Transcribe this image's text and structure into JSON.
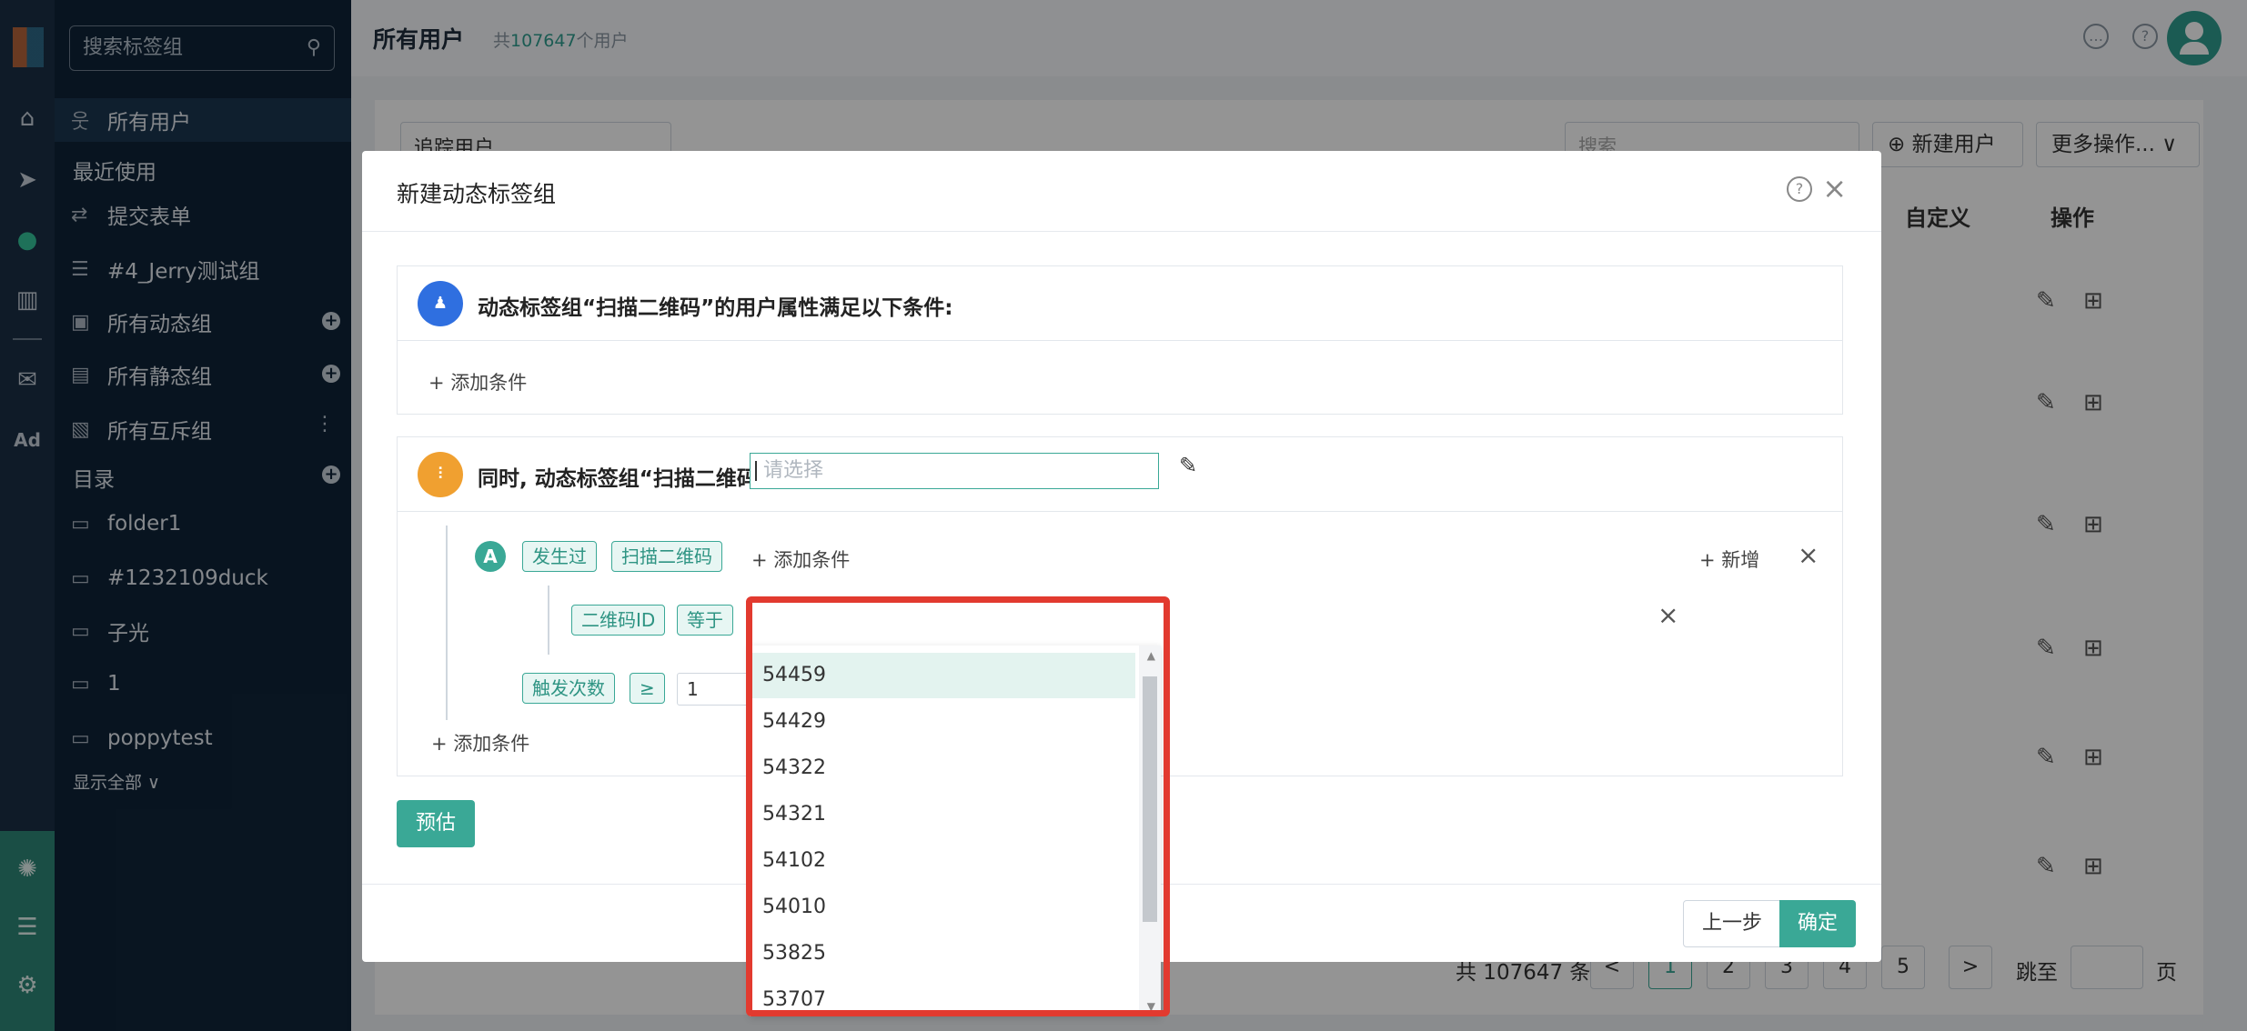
{
  "sidebar": {
    "search_placeholder": "搜索标签组",
    "all_users": "所有用户",
    "recent_label": "最近使用",
    "recent": [
      "提交表单",
      "#4_Jerry测试组"
    ],
    "groups": [
      "所有动态组",
      "所有静态组",
      "所有互斥组"
    ],
    "catalog_label": "目录",
    "folders": [
      "folder1",
      "#1232109duck",
      "子光",
      "1",
      "poppytest"
    ],
    "show_all": "显示全部 ∨"
  },
  "rail": {
    "ad_label": "Ad"
  },
  "header": {
    "title": "所有用户",
    "count_prefix": "共",
    "count_value": "107647",
    "count_suffix": "个用户"
  },
  "background": {
    "filter_select": "追踪用户",
    "search_placeholder": "搜索",
    "new_user_button": "新建用户",
    "more_actions_button": "更多操作...",
    "col_custom": "自定义",
    "col_actions": "操作",
    "pagination": {
      "total_text": "共 107647 条",
      "pages": [
        "1",
        "2",
        "3",
        "4",
        "5"
      ],
      "jump_label": "跳至",
      "page_label": "页",
      "next": ">",
      "prev": "<"
    }
  },
  "modal": {
    "title": "新建动态标签组",
    "section1": {
      "title": "动态标签组“扫描二维码”的用户属性满足以下条件:",
      "add_condition": "+ 添加条件"
    },
    "section2": {
      "title": "同时, 动态标签组“扫描二维码”的用户发生以下事件:",
      "marker": "A",
      "tag_occurred": "发生过",
      "tag_event": "扫描二维码",
      "add_condition_inline": "+ 添加条件",
      "add_new": "+ 新增",
      "sub_tag_field": "二维码ID",
      "sub_tag_op": "等于",
      "select_placeholder": "请选择",
      "count_tag": "触发次数",
      "count_op": "≥",
      "count_value": "1",
      "add_condition_bottom": "+ 添加条件"
    },
    "dropdown_options": [
      "54459",
      "54429",
      "54322",
      "54321",
      "54102",
      "54010",
      "53825",
      "53707"
    ],
    "estimate_button": "预估",
    "prev_button": "上一步",
    "confirm_button": "确定"
  },
  "colors": {
    "accent": "#3aa896",
    "highlight_box": "#e23a2f",
    "section1_badge": "#2f6fe0",
    "section2_badge": "#f0a030"
  }
}
